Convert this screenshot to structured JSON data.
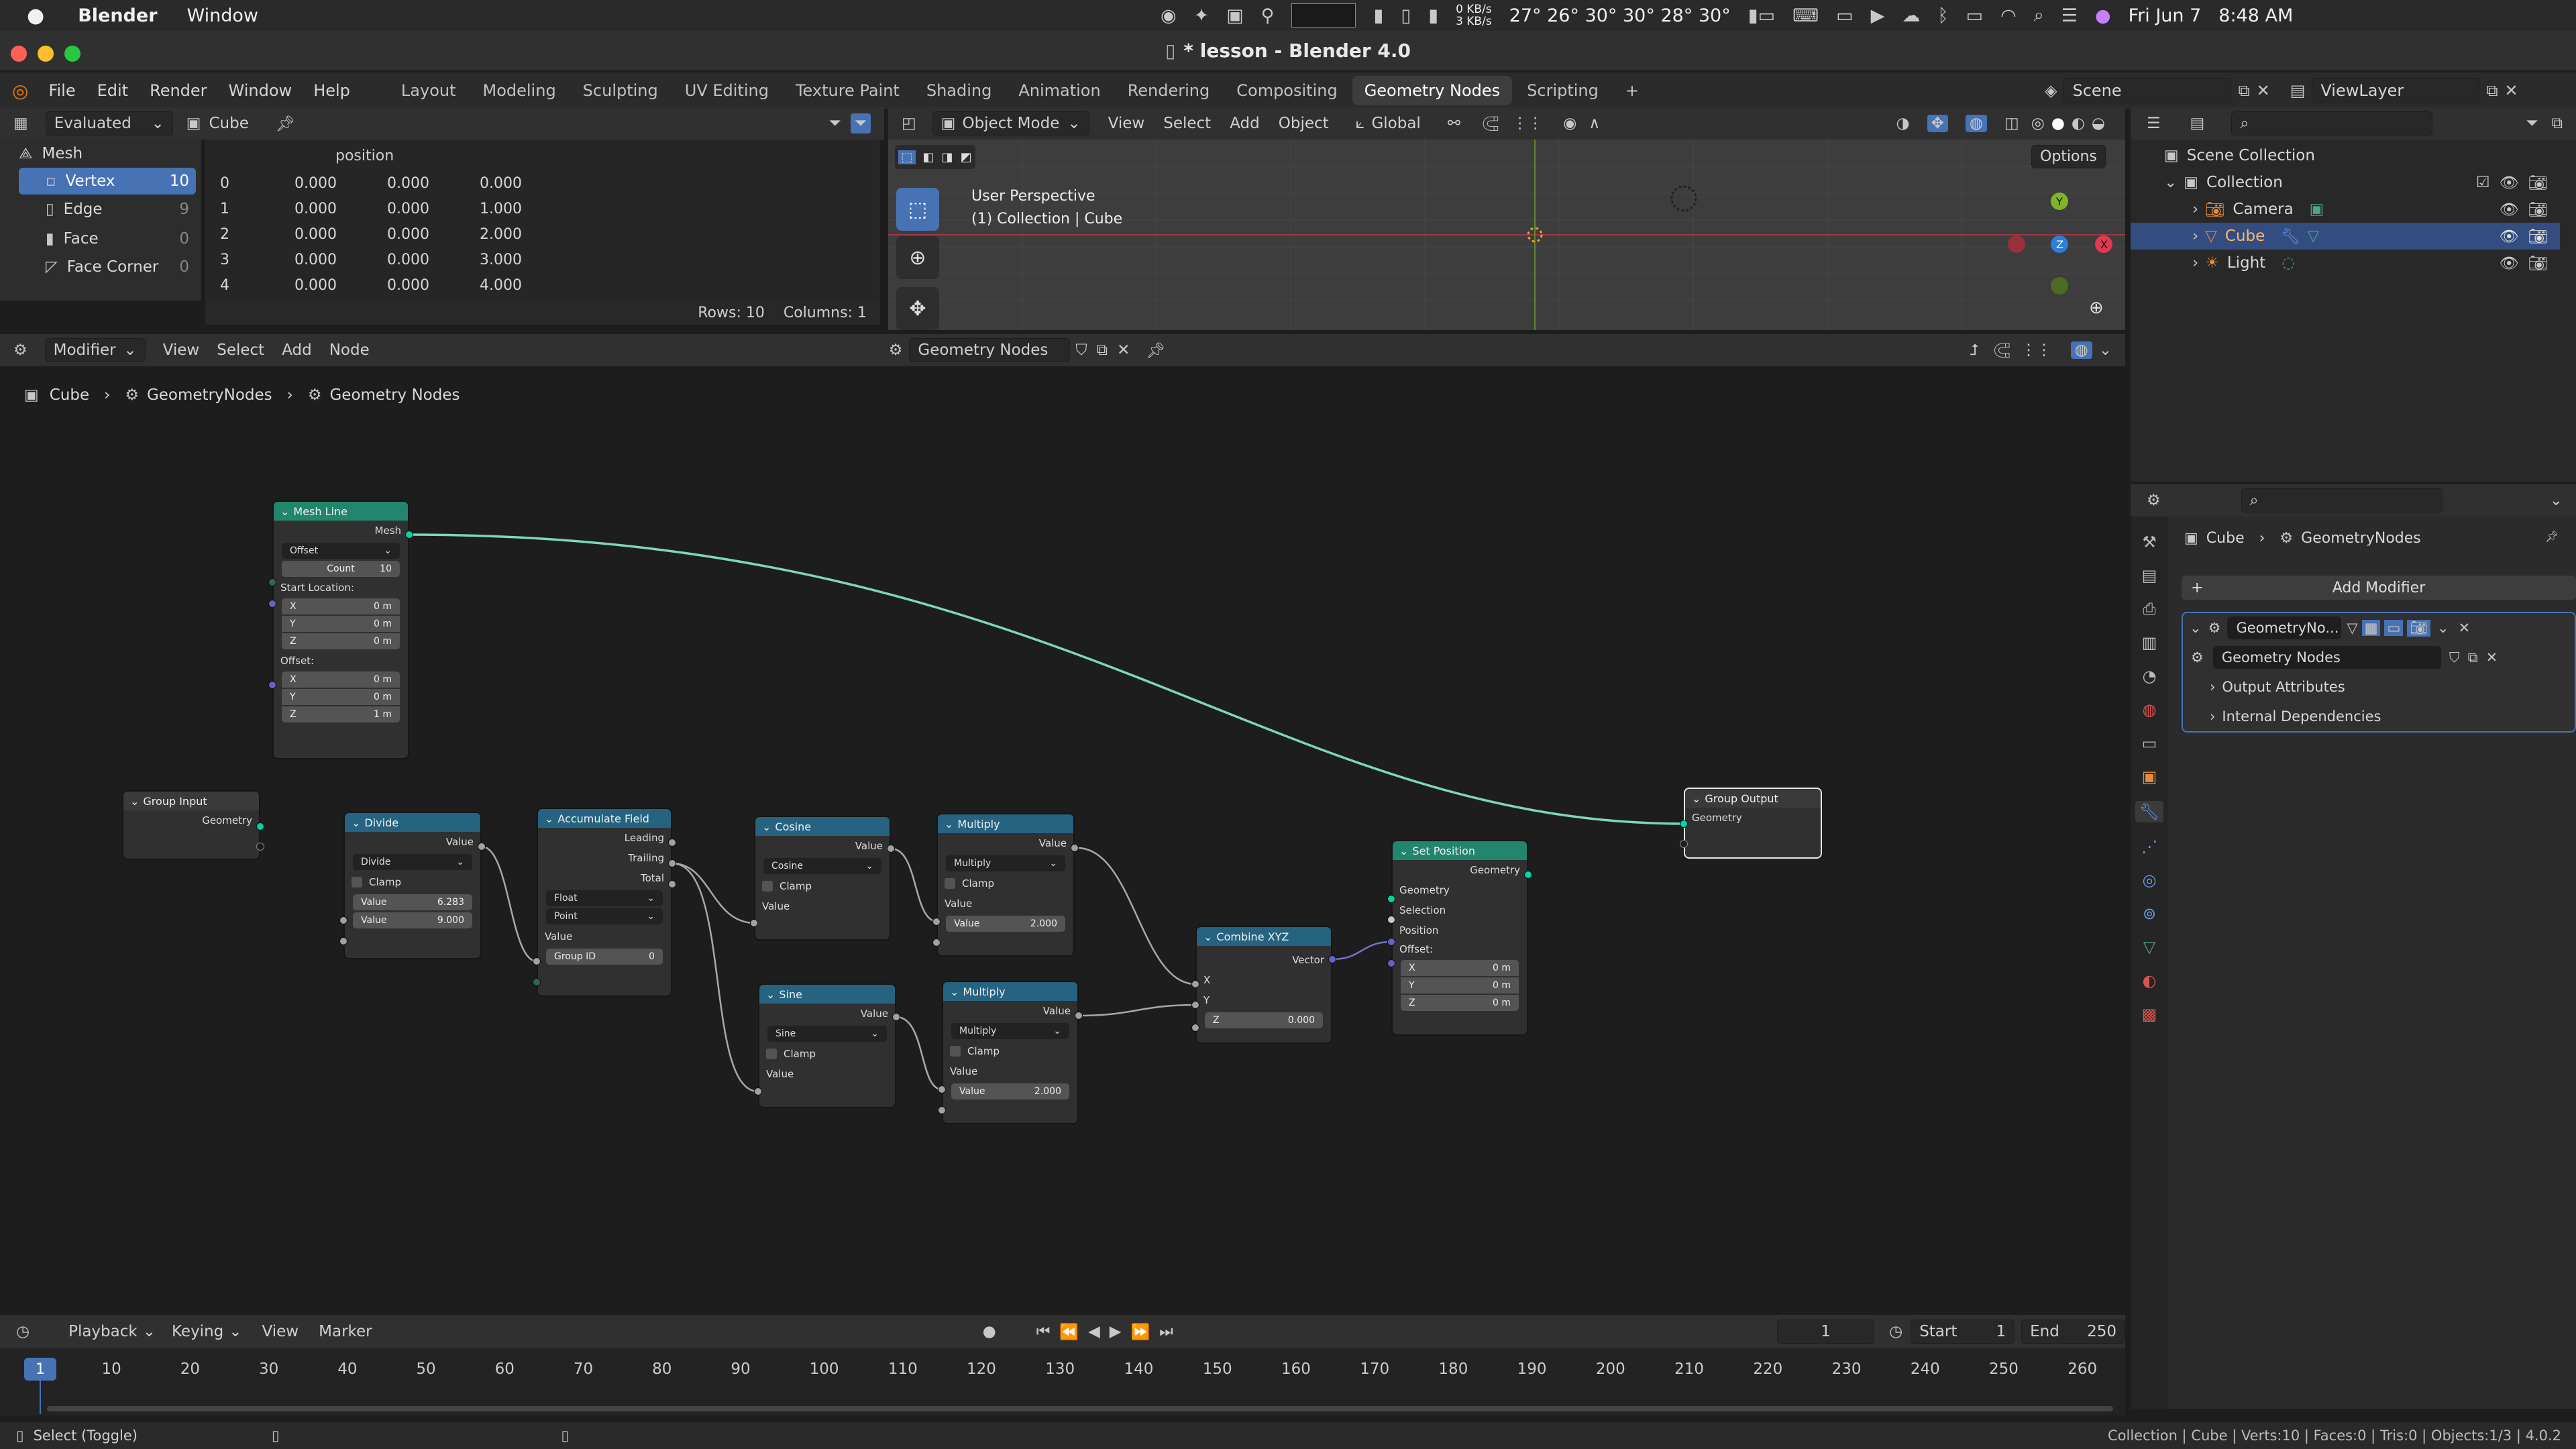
{
  "macos": {
    "apple": "",
    "app": "Blender",
    "menu": "Window",
    "net_up": "0 KB/s",
    "net_down": "3 KB/s",
    "temps": "27° 26° 30° 30° 28° 30°",
    "date": "Fri Jun 7",
    "time": "8:48 AM"
  },
  "window": {
    "title": "* lesson - Blender 4.0"
  },
  "menus": [
    "File",
    "Edit",
    "Render",
    "Window",
    "Help"
  ],
  "workspaces": [
    "Layout",
    "Modeling",
    "Sculpting",
    "UV Editing",
    "Texture Paint",
    "Shading",
    "Animation",
    "Rendering",
    "Compositing",
    "Geometry Nodes",
    "Scripting"
  ],
  "active_workspace": "Geometry Nodes",
  "scene": {
    "label": "Scene",
    "viewlayer": "ViewLayer"
  },
  "spreadsheet": {
    "mode": "Evaluated",
    "object": "Cube",
    "column": "position",
    "domains": [
      {
        "name": "Vertex",
        "count": "10"
      },
      {
        "name": "Edge",
        "count": "9"
      },
      {
        "name": "Face",
        "count": "0"
      },
      {
        "name": "Face Corner",
        "count": "0"
      }
    ],
    "mesh_label": "Mesh",
    "rows": [
      {
        "i": "0",
        "x": "0.000",
        "y": "0.000",
        "z": "0.000"
      },
      {
        "i": "1",
        "x": "0.000",
        "y": "0.000",
        "z": "1.000"
      },
      {
        "i": "2",
        "x": "0.000",
        "y": "0.000",
        "z": "2.000"
      },
      {
        "i": "3",
        "x": "0.000",
        "y": "0.000",
        "z": "3.000"
      },
      {
        "i": "4",
        "x": "0.000",
        "y": "0.000",
        "z": "4.000"
      }
    ],
    "footer_rows": "Rows: 10",
    "footer_cols": "Columns: 1"
  },
  "viewport": {
    "mode": "Object Mode",
    "menus": [
      "View",
      "Select",
      "Add",
      "Object"
    ],
    "orientation": "Global",
    "options": "Options",
    "perspective": "User Perspective",
    "collection": "(1) Collection | Cube"
  },
  "outliner": {
    "root": "Scene Collection",
    "collection": "Collection",
    "items": [
      {
        "name": "Camera",
        "selected": false
      },
      {
        "name": "Cube",
        "selected": true
      },
      {
        "name": "Light",
        "selected": false
      }
    ]
  },
  "node_editor": {
    "type": "Modifier",
    "menus": [
      "View",
      "Select",
      "Add",
      "Node"
    ],
    "tree": "Geometry Nodes",
    "breadcrumb": [
      "Cube",
      "GeometryNodes",
      "Geometry Nodes"
    ]
  },
  "nodes": {
    "mesh_line": {
      "title": "Mesh Line",
      "out": "Mesh",
      "mode": "Offset",
      "count_label": "Count",
      "count": "10",
      "start": "Start Location:",
      "sx": "0 m",
      "sy": "0 m",
      "sz": "0 m",
      "offset": "Offset:",
      "ox": "0 m",
      "oy": "0 m",
      "oz": "1 m",
      "x": "X",
      "y": "Y",
      "z": "Z"
    },
    "group_input": {
      "title": "Group Input",
      "out": "Geometry"
    },
    "divide": {
      "title": "Divide",
      "out": "Value",
      "op": "Divide",
      "clamp": "Clamp",
      "v1_label": "Value",
      "v1": "6.283",
      "v2_label": "Value",
      "v2": "9.000"
    },
    "accumulate": {
      "title": "Accumulate Field",
      "o1": "Leading",
      "o2": "Trailing",
      "o3": "Total",
      "type": "Float",
      "domain": "Point",
      "in": "Value",
      "gid_label": "Group ID",
      "gid": "0"
    },
    "cosine": {
      "title": "Cosine",
      "out": "Value",
      "op": "Cosine",
      "clamp": "Clamp",
      "in": "Value"
    },
    "sine": {
      "title": "Sine",
      "out": "Value",
      "op": "Sine",
      "clamp": "Clamp",
      "in": "Value"
    },
    "multiply1": {
      "title": "Multiply",
      "out": "Value",
      "op": "Multiply",
      "clamp": "Clamp",
      "in": "Value",
      "v_label": "Value",
      "v": "2.000"
    },
    "multiply2": {
      "title": "Multiply",
      "out": "Value",
      "op": "Multiply",
      "clamp": "Clamp",
      "in": "Value",
      "v_label": "Value",
      "v": "2.000"
    },
    "combine": {
      "title": "Combine XYZ",
      "out": "Vector",
      "x": "X",
      "y": "Y",
      "z_label": "Z",
      "z": "0.000"
    },
    "set_position": {
      "title": "Set Position",
      "out": "Geometry",
      "in1": "Geometry",
      "in2": "Selection",
      "in3": "Position",
      "offset": "Offset:",
      "x": "X",
      "y": "Y",
      "z": "Z",
      "ox": "0 m",
      "oy": "0 m",
      "oz": "0 m"
    },
    "group_output": {
      "title": "Group Output",
      "in": "Geometry"
    }
  },
  "properties": {
    "breadcrumb_object": "Cube",
    "breadcrumb_mod": "GeometryNodes",
    "add_modifier": "Add Modifier",
    "modifier_name": "GeometryNo...",
    "tree": "Geometry Nodes",
    "sections": [
      "Output Attributes",
      "Internal Dependencies"
    ]
  },
  "timeline": {
    "menus": [
      "Playback",
      "Keying",
      "View",
      "Marker"
    ],
    "current_frame": "1",
    "start_label": "Start",
    "start": "1",
    "end_label": "End",
    "end": "250",
    "ticks": [
      "10",
      "20",
      "30",
      "40",
      "50",
      "60",
      "70",
      "80",
      "90",
      "100",
      "110",
      "120",
      "130",
      "140",
      "150",
      "160",
      "170",
      "180",
      "190",
      "200",
      "210",
      "220",
      "230",
      "240",
      "250",
      "260"
    ],
    "playhead": "1"
  },
  "statusbar": {
    "left": "Select (Toggle)",
    "right": "Collection | Cube | Verts:10 | Faces:0 | Tris:0 | Objects:1/3 | 4.0.2"
  },
  "colors": {
    "geo_socket": "#00d6a3",
    "float_socket": "#a1a1a1",
    "vector_socket": "#6363c7",
    "int_socket": "#35684a",
    "mesh_header": "#22856d",
    "math_header": "#256380",
    "accent": "#4772b3"
  }
}
